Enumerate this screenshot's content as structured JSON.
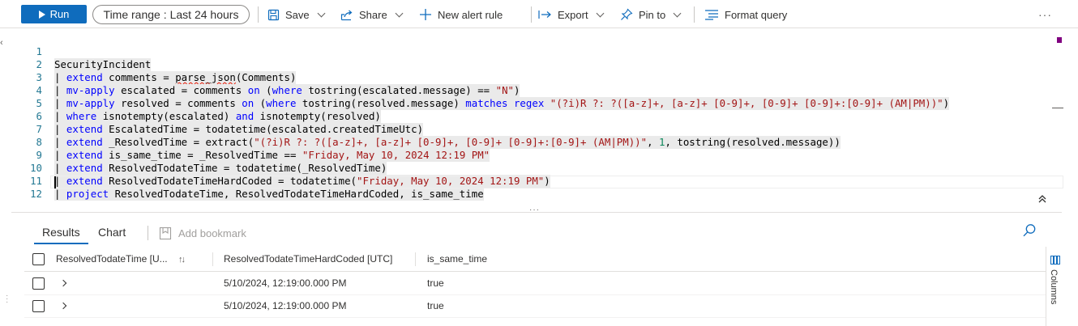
{
  "toolbar": {
    "run_label": "Run",
    "time_range_label": "Time range :",
    "time_range_value": "Last 24 hours",
    "save_label": "Save",
    "share_label": "Share",
    "new_alert_label": "New alert rule",
    "export_label": "Export",
    "pin_label": "Pin to",
    "format_label": "Format query",
    "more_label": "···"
  },
  "editor": {
    "line_numbers": [
      "1",
      "2",
      "3",
      "4",
      "5",
      "6",
      "7",
      "8",
      "9",
      "10",
      "11",
      "12"
    ]
  },
  "results": {
    "tabs": [
      "Results",
      "Chart"
    ],
    "bookmark_label": "Add bookmark",
    "columns": [
      "ResolvedTodateTime [U...",
      "ResolvedTodateTimeHardCoded [UTC]",
      "is_same_time"
    ],
    "rows": [
      {
        "ResolvedTodateTime": "",
        "ResolvedTodateTimeHardCoded": "5/10/2024, 12:19:00.000 PM",
        "is_same_time": "true"
      },
      {
        "ResolvedTodateTime": "",
        "ResolvedTodateTimeHardCoded": "5/10/2024, 12:19:00.000 PM",
        "is_same_time": "true"
      }
    ],
    "columns_panel_label": "Columns"
  },
  "colors": {
    "accent": "#0f6cbd",
    "keyword": "#0000ff",
    "string": "#a31515",
    "number": "#098658",
    "line_number": "#237893"
  }
}
